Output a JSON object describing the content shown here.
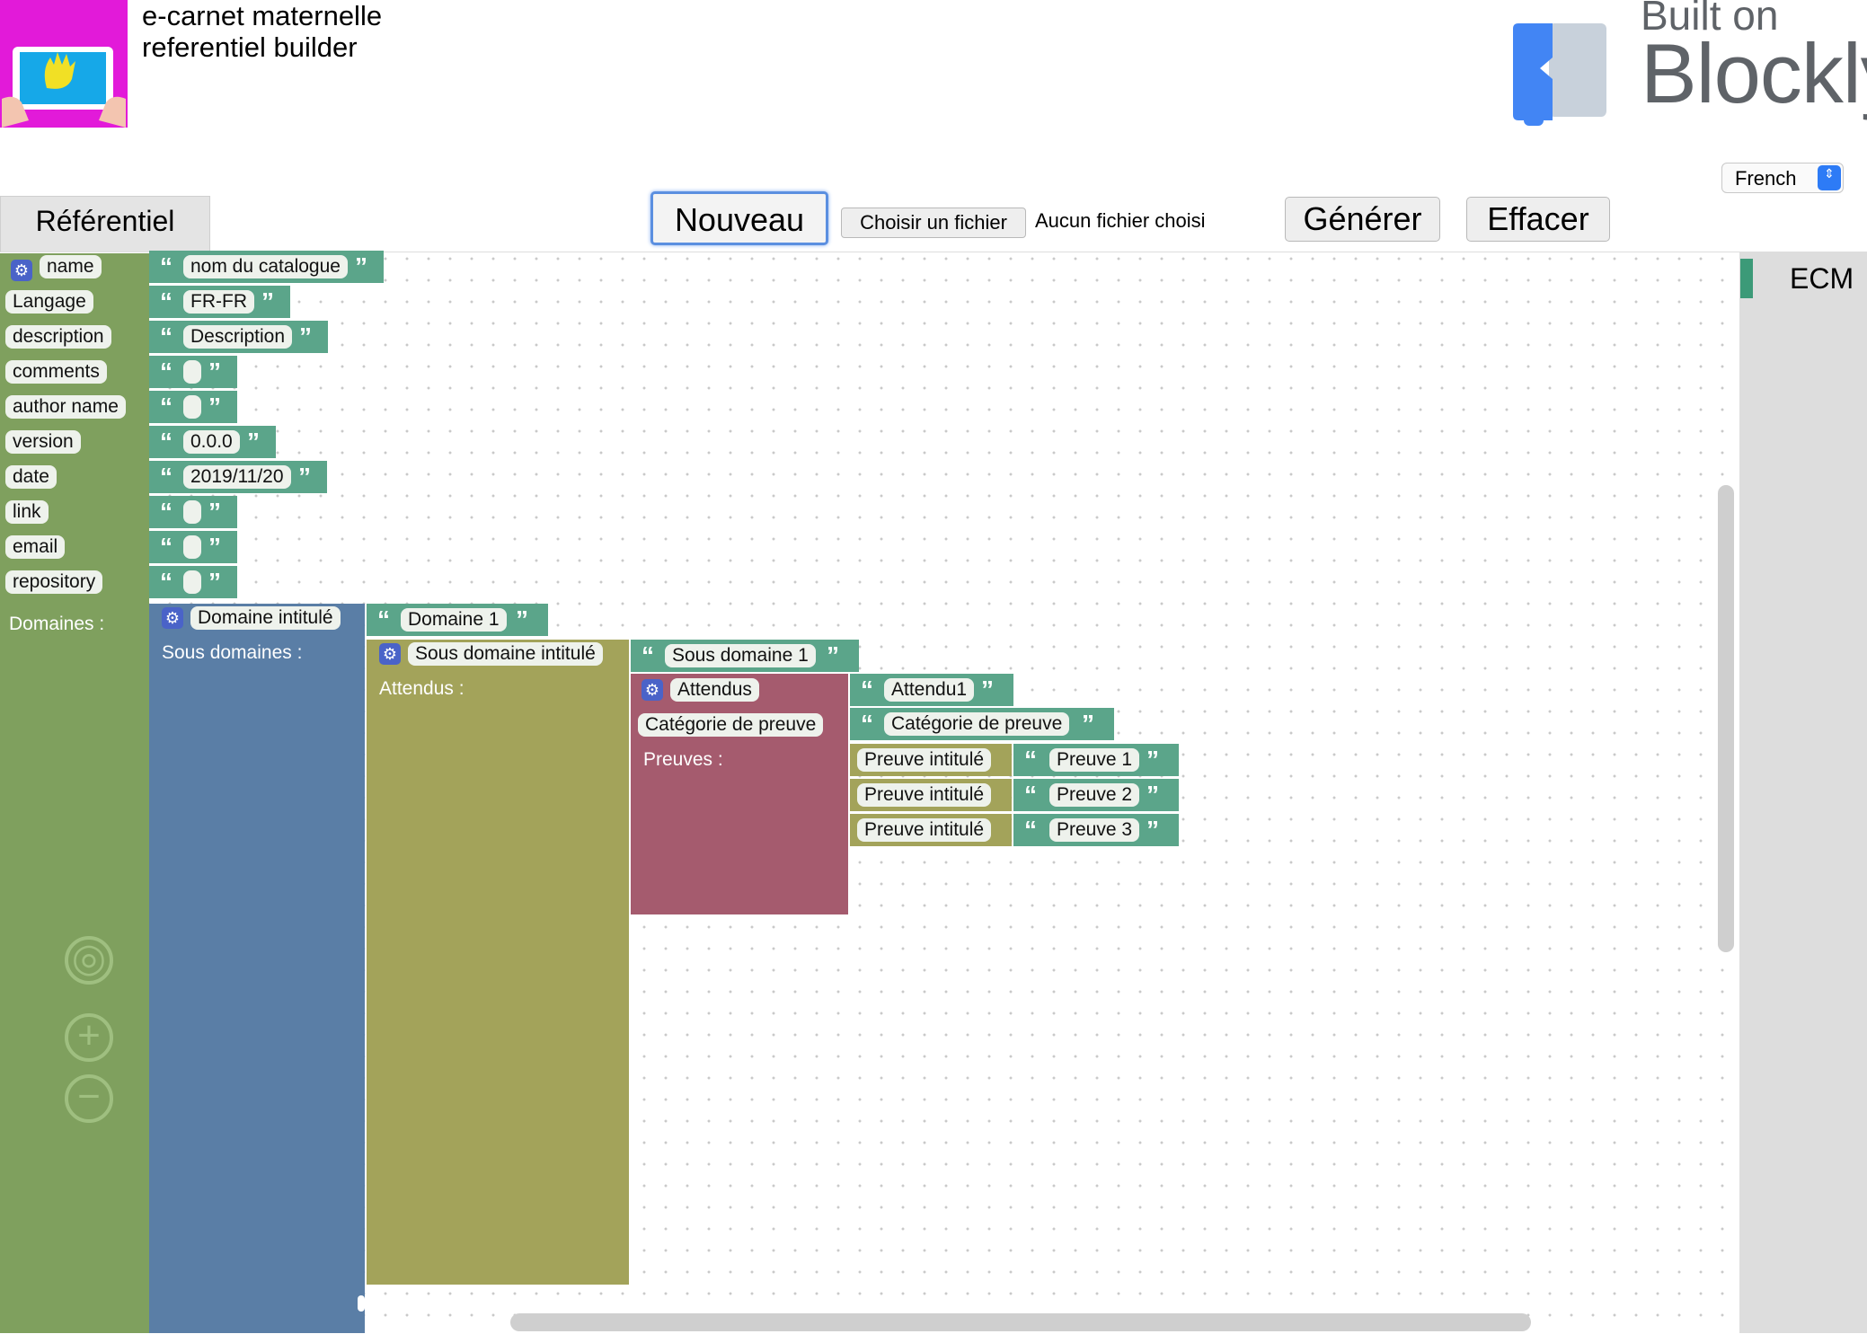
{
  "app": {
    "title_line1": "e-carnet maternelle",
    "title_line2": "referentiel builder"
  },
  "branding": {
    "built_on": "Built on",
    "blockly": "Blockly"
  },
  "language_select": {
    "value": "French",
    "arrow": "⇕"
  },
  "toolbar": {
    "tab_label": "Référentiel",
    "new_label": "Nouveau",
    "choose_file_label": "Choisir un fichier",
    "no_file_label": "Aucun fichier choisi",
    "generate_label": "Générer",
    "clear_label": "Effacer"
  },
  "flyout": {
    "category": "ECM"
  },
  "zoom": {
    "reset": "◎",
    "in": "+",
    "out": "−"
  },
  "referentiel_block": {
    "fields": [
      {
        "label": "name",
        "value": "nom du catalogue"
      },
      {
        "label": "Langage",
        "value": "FR-FR"
      },
      {
        "label": "description",
        "value": "Description"
      },
      {
        "label": "comments",
        "value": ""
      },
      {
        "label": "author name",
        "value": ""
      },
      {
        "label": "version",
        "value": "0.0.0"
      },
      {
        "label": "date",
        "value": "2019/11/20"
      },
      {
        "label": "link",
        "value": ""
      },
      {
        "label": "email",
        "value": ""
      },
      {
        "label": "repository",
        "value": ""
      }
    ],
    "domaines_label": "Domaines :"
  },
  "domaine_block": {
    "title": "Domaine intitulé",
    "value": "Domaine 1",
    "sub_label": "Sous domaines :"
  },
  "sous_domaine_block": {
    "title": "Sous domaine intitulé",
    "value": "Sous domaine 1",
    "sub_label": "Attendus :"
  },
  "attendus_block": {
    "title": "Attendus",
    "value": "Attendu1",
    "category_label": "Catégorie de preuve",
    "category_value": "Catégorie de preuve",
    "preuves_label": "Preuves :"
  },
  "preuves": [
    {
      "label": "Preuve intitulé",
      "value": "Preuve 1"
    },
    {
      "label": "Preuve intitulé",
      "value": "Preuve 2"
    },
    {
      "label": "Preuve intitulé",
      "value": "Preuve 3"
    }
  ],
  "colors": {
    "referentiel": "#7fa05e",
    "domaine": "#5a7ea6",
    "sous_domaine": "#a3a35a",
    "attendus": "#a55b6e",
    "text": "#5ba58a",
    "accent": "#2d7bf6"
  }
}
